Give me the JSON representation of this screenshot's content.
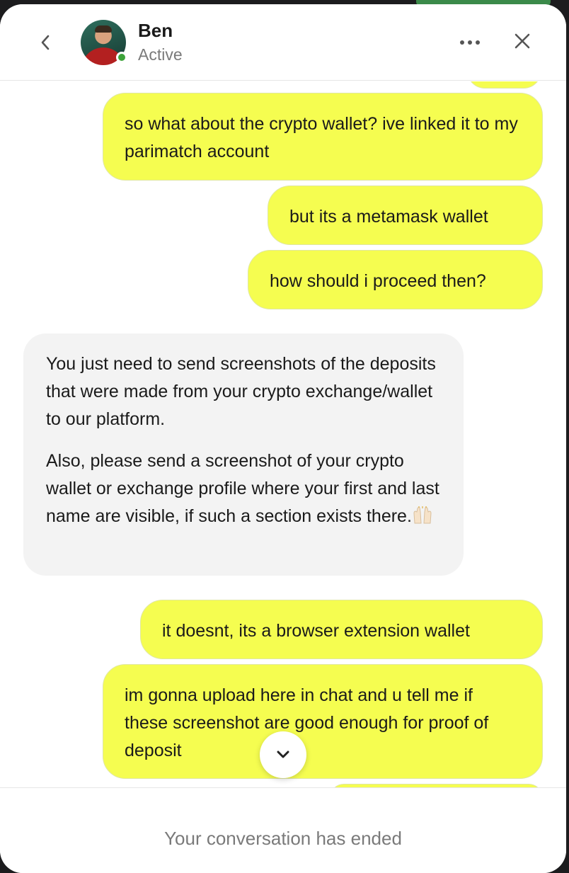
{
  "header": {
    "name": "Ben",
    "status": "Active",
    "icons": {
      "back": "chevron-left-icon",
      "more": "more-horizontal-icon",
      "close": "close-icon"
    }
  },
  "messages": [
    {
      "from": "user",
      "text": "so what about the crypto wallet? ive linked it to my parimatch account"
    },
    {
      "from": "user",
      "text": "but its a metamask wallet"
    },
    {
      "from": "user",
      "text": "how should i proceed then?"
    },
    {
      "from": "agent",
      "paragraphs": [
        "You just need to send screenshots of the deposits that were made from your crypto exchange/wallet to our platform.",
        "Also, please send a screenshot of your crypto wallet or exchange profile where your first and last name are visible, if such a section exists there."
      ],
      "emoji": "raised-hands-icon"
    },
    {
      "from": "user",
      "text": "it doesnt, its a browser extension wallet"
    },
    {
      "from": "user",
      "text": "im gonna upload here in chat and u tell me if these screenshot are good enough for proof of deposit"
    }
  ],
  "footer": {
    "text": "Your conversation has ended"
  },
  "colors": {
    "user_bubble": "#f5fd50",
    "agent_bubble": "#f3f3f3",
    "online": "#3da33a"
  }
}
